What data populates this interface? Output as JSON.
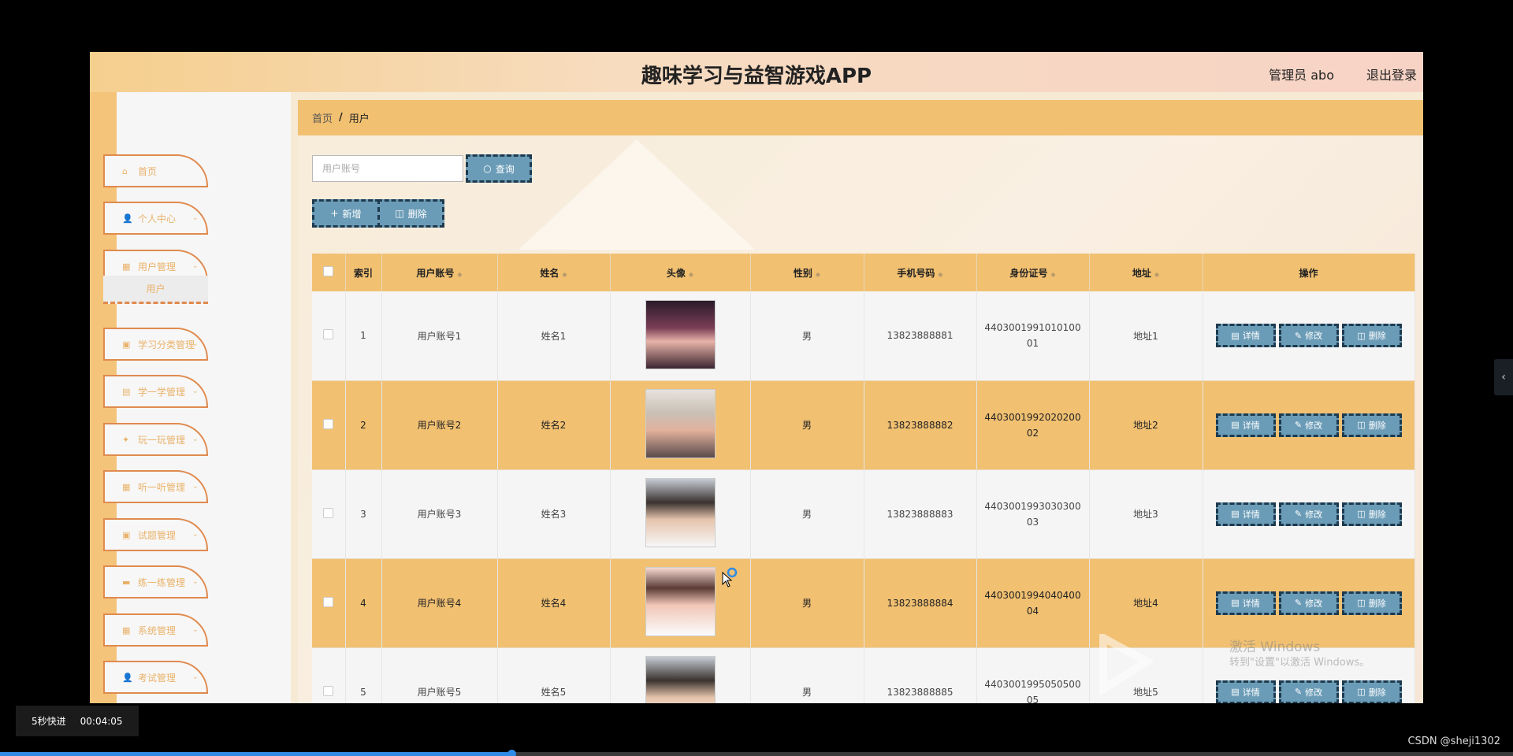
{
  "app": {
    "title": "趣味学习与益智游戏APP",
    "admin_label": "管理员 abo",
    "logout_label": "退出登录"
  },
  "sidebar": {
    "items": [
      {
        "label": "首页",
        "icon": "home-icon",
        "glyph": "⌂",
        "has_chevron": false
      },
      {
        "label": "个人中心",
        "icon": "user-icon",
        "glyph": "👤",
        "has_chevron": true
      },
      {
        "label": "用户管理",
        "icon": "grid-icon",
        "glyph": "▦",
        "has_chevron": true
      },
      {
        "label": "学习分类管理",
        "icon": "clipboard-icon",
        "glyph": "▣",
        "has_chevron": true
      },
      {
        "label": "学一学管理",
        "icon": "briefcase-icon",
        "glyph": "▤",
        "has_chevron": true
      },
      {
        "label": "玩一玩管理",
        "icon": "thumb-icon",
        "glyph": "✦",
        "has_chevron": true
      },
      {
        "label": "听一听管理",
        "icon": "grid-icon",
        "glyph": "▦",
        "has_chevron": true
      },
      {
        "label": "试题管理",
        "icon": "clipboard-icon",
        "glyph": "▣",
        "has_chevron": true
      },
      {
        "label": "练一练管理",
        "icon": "chat-icon",
        "glyph": "▬",
        "has_chevron": true
      },
      {
        "label": "系统管理",
        "icon": "grid-icon",
        "glyph": "▦",
        "has_chevron": true
      },
      {
        "label": "考试管理",
        "icon": "user-icon",
        "glyph": "👤",
        "has_chevron": true
      }
    ],
    "submenu_item": "用户"
  },
  "breadcrumb": {
    "home": "首页",
    "separator": "/",
    "current": "用户"
  },
  "search": {
    "placeholder": "用户账号",
    "value": "",
    "button_label": "查询"
  },
  "toolbar": {
    "add_label": "新增",
    "delete_label": "删除"
  },
  "table": {
    "columns": [
      "索引",
      "用户账号",
      "姓名",
      "头像",
      "性别",
      "手机号码",
      "身份证号",
      "地址",
      "操作"
    ],
    "rows": [
      {
        "index": "1",
        "account": "用户账号1",
        "name": "姓名1",
        "gender": "男",
        "phone": "13823888881",
        "id_card": "440300199101010001",
        "address": "地址1"
      },
      {
        "index": "2",
        "account": "用户账号2",
        "name": "姓名2",
        "gender": "男",
        "phone": "13823888882",
        "id_card": "440300199202020002",
        "address": "地址2"
      },
      {
        "index": "3",
        "account": "用户账号3",
        "name": "姓名3",
        "gender": "男",
        "phone": "13823888883",
        "id_card": "440300199303030003",
        "address": "地址3"
      },
      {
        "index": "4",
        "account": "用户账号4",
        "name": "姓名4",
        "gender": "男",
        "phone": "13823888884",
        "id_card": "440300199404040004",
        "address": "地址4"
      },
      {
        "index": "5",
        "account": "用户账号5",
        "name": "姓名5",
        "gender": "男",
        "phone": "13823888885",
        "id_card": "440300199505050005",
        "address": "地址5"
      }
    ],
    "actions": {
      "detail": "详情",
      "edit": "修改",
      "delete": "删除"
    }
  },
  "watermark": {
    "line1": "激活 Windows",
    "line2": "转到\"设置\"以激活 Windows。"
  },
  "video": {
    "speed_label": "5秒快进",
    "time": "00:04:05",
    "progress_fraction": 0.338
  },
  "csdn": "CSDN @sheji1302",
  "colors": {
    "accent": "#f1c071",
    "button": "#6b9cb7",
    "sidebar_border": "#e08a4e",
    "progress": "#2f8be6"
  }
}
